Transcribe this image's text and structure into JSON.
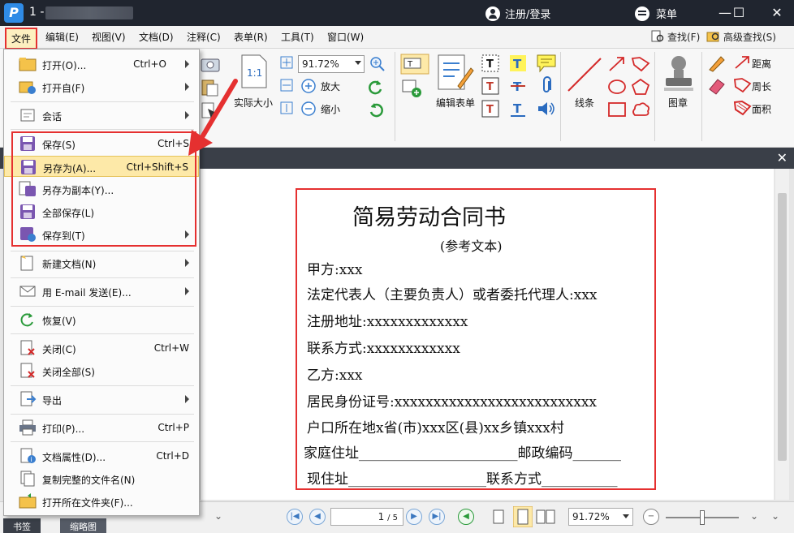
{
  "window": {
    "title": "1 -",
    "login": "注册/登录",
    "menu": "菜单",
    "minimize": "—",
    "maximize": "☐",
    "close": "✕"
  },
  "menubar": {
    "items": [
      "文件",
      "编辑(E)",
      "视图(V)",
      "文档(D)",
      "注释(C)",
      "表单(R)",
      "工具(T)",
      "窗口(W)"
    ],
    "find": "查找(F)",
    "advanced_find": "高级查找(S)"
  },
  "ribbon": {
    "actual_size": "实际大小",
    "zoom_value": "91.72%",
    "zoom_in": "放大",
    "zoom_out": "缩小",
    "edit_form": "编辑表单",
    "lines": "线条",
    "stamp": "图章",
    "distance": "距离",
    "perimeter": "周长",
    "area": "面积"
  },
  "file_menu": {
    "items": [
      {
        "label": "打开(O)...",
        "shortcut": "Ctrl+O",
        "submenu": true,
        "icon": "open-folder-icon"
      },
      {
        "label": "打开自(F)",
        "shortcut": "",
        "submenu": true,
        "icon": "open-from-icon"
      },
      {
        "label": "会话",
        "shortcut": "",
        "submenu": true,
        "icon": "session-icon"
      },
      {
        "label": "保存(S)",
        "shortcut": "Ctrl+S",
        "submenu": false,
        "icon": "save-icon"
      },
      {
        "label": "另存为(A)...",
        "shortcut": "Ctrl+Shift+S",
        "submenu": false,
        "icon": "save-as-icon"
      },
      {
        "label": "另存为副本(Y)...",
        "shortcut": "",
        "submenu": false,
        "icon": "save-copy-icon"
      },
      {
        "label": "全部保存(L)",
        "shortcut": "",
        "submenu": false,
        "icon": "save-all-icon"
      },
      {
        "label": "保存到(T)",
        "shortcut": "",
        "submenu": true,
        "icon": "save-to-icon"
      },
      {
        "label": "新建文档(N)",
        "shortcut": "",
        "submenu": true,
        "icon": "new-doc-icon"
      },
      {
        "label": "用 E-mail 发送(E)...",
        "shortcut": "",
        "submenu": true,
        "icon": "email-icon"
      },
      {
        "label": "恢复(V)",
        "shortcut": "",
        "submenu": false,
        "icon": "restore-icon"
      },
      {
        "label": "关闭(C)",
        "shortcut": "Ctrl+W",
        "submenu": false,
        "icon": "close-doc-icon"
      },
      {
        "label": "关闭全部(S)",
        "shortcut": "",
        "submenu": false,
        "icon": "close-all-icon"
      },
      {
        "label": "导出",
        "shortcut": "",
        "submenu": true,
        "icon": "export-icon"
      },
      {
        "label": "打印(P)...",
        "shortcut": "Ctrl+P",
        "submenu": false,
        "icon": "print-icon"
      },
      {
        "label": "文档属性(D)...",
        "shortcut": "Ctrl+D",
        "submenu": false,
        "icon": "doc-properties-icon"
      },
      {
        "label": "复制完整的文件名(N)",
        "shortcut": "",
        "submenu": false,
        "icon": "copy-filename-icon"
      },
      {
        "label": "打开所在文件夹(F)...",
        "shortcut": "",
        "submenu": false,
        "icon": "open-containing-folder-icon"
      }
    ]
  },
  "document": {
    "title": "简易劳动合同书",
    "subtitle": "(参考文本)",
    "lines": [
      "甲方:xxx",
      "法定代表人（主要负责人）或者委托代理人:xxx",
      "注册地址:xxxxxxxxxxxxx",
      "联系方式:xxxxxxxxxxxx",
      "乙方:xxx",
      "居民身份证号:xxxxxxxxxxxxxxxxxxxxxxxxxx",
      "户口所在地x省(市)xxx区(县)xx乡镇xxx村",
      "家庭住址_______________________邮政编码_______",
      "现住址____________________联系方式___________"
    ]
  },
  "statusbar": {
    "page": "1",
    "page_total": "/ 5",
    "zoom": "91.72%",
    "tabs": [
      "书签",
      "缩略图"
    ]
  },
  "colors": {
    "accent_red": "#e53030",
    "titlebar": "#20252f",
    "highlight": "#fde9a8"
  }
}
